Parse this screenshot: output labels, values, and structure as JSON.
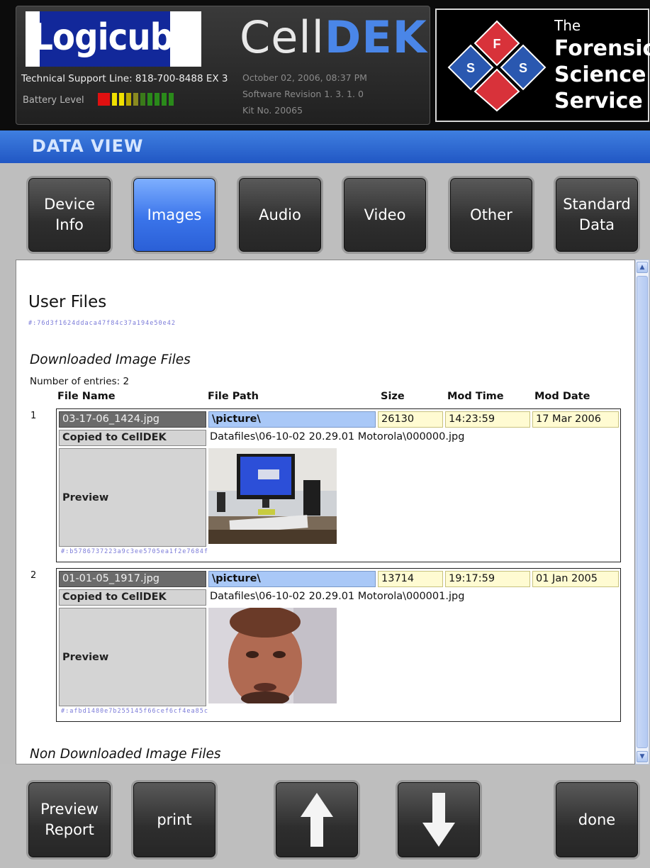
{
  "header": {
    "logo_text": "Logicube",
    "support_line": "Technical Support Line: 818-700-8488 EX 3",
    "battery_label": "Battery Level",
    "battery_level_fraction": 0.35,
    "product_name_light": "Cell",
    "product_name_bold": "DEK",
    "datetime": "October 02, 2006, 08:37 PM",
    "software_revision": "Software Revision 1. 3. 1. 0",
    "kit_no": "Kit No. 20065",
    "fss": {
      "line1": "The",
      "line2": "Forensic",
      "line3": "Science",
      "line4": "Service",
      "letters": [
        "F",
        "S",
        "S"
      ],
      "colors": {
        "red": "#d8323a",
        "blue": "#2a58b0"
      }
    }
  },
  "title_bar": {
    "label": "DATA VIEW"
  },
  "tabs": [
    {
      "label": "Device\nInfo",
      "active": false
    },
    {
      "label": "Images",
      "active": true
    },
    {
      "label": "Audio",
      "active": false
    },
    {
      "label": "Video",
      "active": false
    },
    {
      "label": "Other",
      "active": false
    },
    {
      "label": "Standard\nData",
      "active": false
    }
  ],
  "content": {
    "section_title": "User Files",
    "section_hash": "#:76d3f1624ddaca47f84c37a194e50e42",
    "downloaded_title": "Downloaded Image Files",
    "entries_count": "Number of entries: 2",
    "columns": [
      "File Name",
      "File Path",
      "Size",
      "Mod Time",
      "Mod Date"
    ],
    "records": [
      {
        "num": "1",
        "file_name": "03-17-06_1424.jpg",
        "file_path": "\\picture\\",
        "size": "26130",
        "mod_time": "14:23:59",
        "mod_date": "17 Mar 2006",
        "copied_label": "Copied to CellDEK",
        "copied_path": "Datafiles\\06-10-02 20.29.01 Motorola\\000000.jpg",
        "preview_label": "Preview",
        "hash": "#:b5786737223a9c3ee5705ea1f2e7684f"
      },
      {
        "num": "2",
        "file_name": "01-01-05_1917.jpg",
        "file_path": "\\picture\\",
        "size": "13714",
        "mod_time": "19:17:59",
        "mod_date": "01 Jan 2005",
        "copied_label": "Copied to CellDEK",
        "copied_path": "Datafiles\\06-10-02 20.29.01 Motorola\\000001.jpg",
        "preview_label": "Preview",
        "hash": "#:afbd1480e7b255145f66cef6cf4ea85c"
      }
    ],
    "non_downloaded_title": "Non Downloaded Image Files"
  },
  "bottom_buttons": {
    "preview_report": "Preview\nReport",
    "print": "print",
    "done": "done"
  },
  "colors": {
    "accent_blue": "#2d6ad6",
    "active_tab": "#3a74ea"
  }
}
